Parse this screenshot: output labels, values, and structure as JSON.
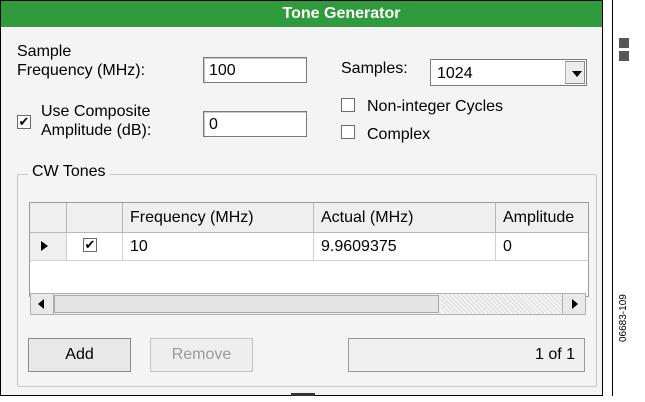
{
  "window": {
    "title": "Tone Generator"
  },
  "form": {
    "sample_frequency_label": [
      "Sample",
      "Frequency (MHz):"
    ],
    "sample_frequency_value": "100",
    "samples_label": "Samples:",
    "samples_value": "1024",
    "use_composite_checked": true,
    "composite_amplitude_label": [
      "Use Composite",
      "Amplitude (dB):"
    ],
    "composite_amplitude_value": "0",
    "non_integer_label": "Non-integer Cycles",
    "non_integer_checked": false,
    "complex_label": "Complex",
    "complex_checked": false
  },
  "cw_tones": {
    "group_label": "CW Tones",
    "columns": [
      "",
      "",
      "Frequency (MHz)",
      "Actual (MHz)",
      "Amplitude"
    ],
    "rows": [
      {
        "selected": true,
        "enabled": true,
        "frequency": "10",
        "actual": "9.9609375",
        "amplitude": "0"
      }
    ]
  },
  "buttons": {
    "add": "Add",
    "remove": "Remove"
  },
  "pager": {
    "text": "1 of 1"
  },
  "figure_id": "06683-109"
}
